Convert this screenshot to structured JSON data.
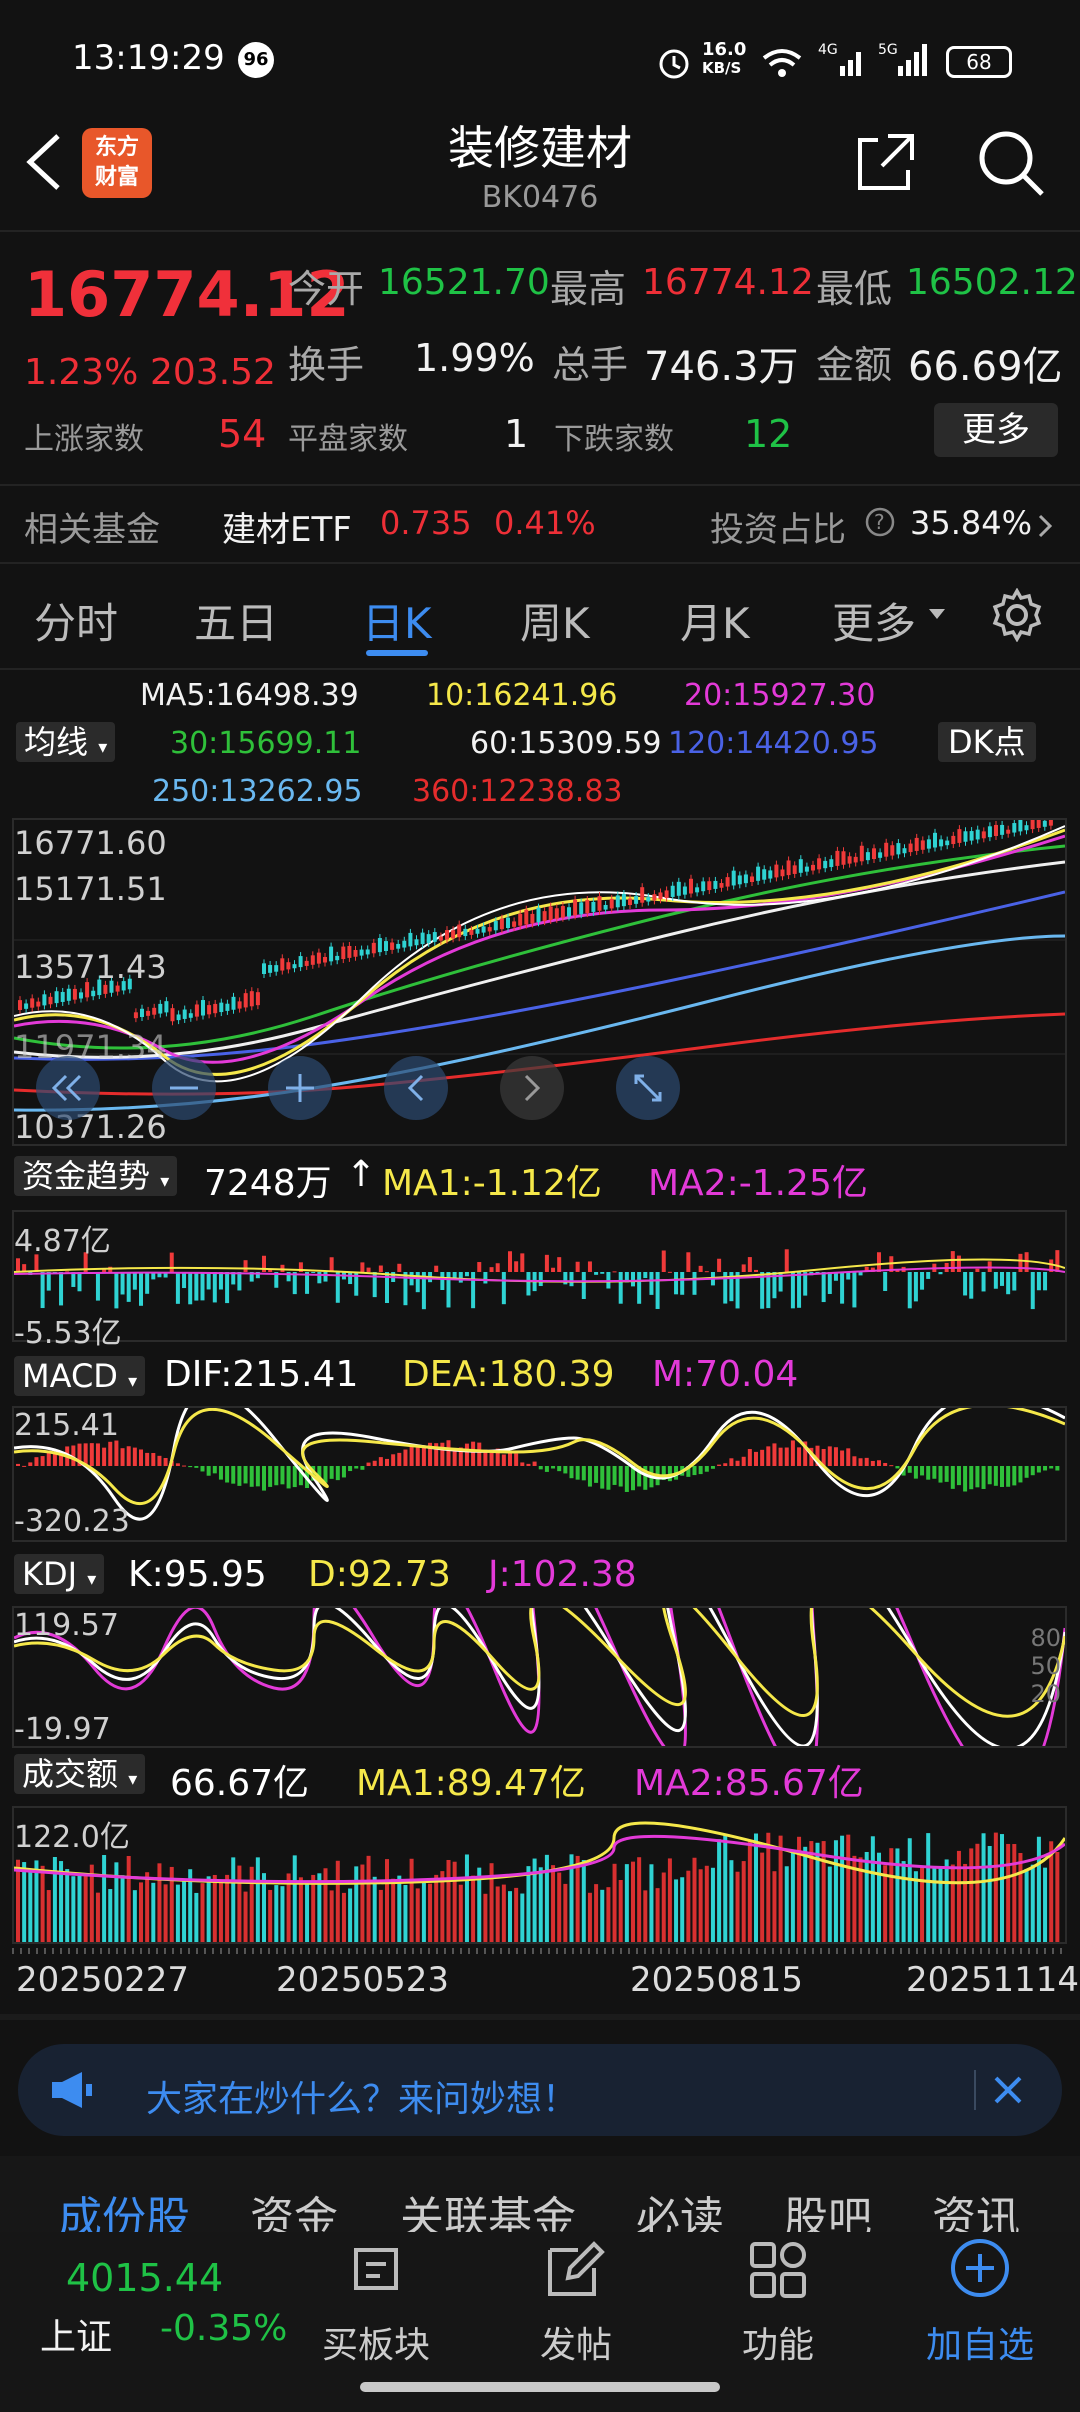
{
  "status": {
    "time": "13:19:29",
    "notif_badge": "96",
    "net_speed": "16.0",
    "net_unit": "KB/S",
    "battery": "68"
  },
  "header": {
    "title": "装修建材",
    "code": "BK0476",
    "logo_line1": "东方",
    "logo_line2": "财富"
  },
  "quote": {
    "price": "16774.12",
    "change_pct": "1.23%",
    "change_abs": "203.52",
    "open_label": "今开",
    "open": "16521.70",
    "high_label": "最高",
    "high": "16774.12",
    "low_label": "最低",
    "low": "16502.12",
    "turnover_label": "换手",
    "turnover": "1.99%",
    "volume_label": "总手",
    "volume": "746.3万",
    "amount_label": "金额",
    "amount": "66.69亿",
    "up_label": "上涨家数",
    "up": "54",
    "flat_label": "平盘家数",
    "flat": "1",
    "down_label": "下跌家数",
    "down": "12",
    "more": "更多"
  },
  "fund": {
    "label": "相关基金",
    "name": "建材ETF",
    "price": "0.735",
    "pct": "0.41%",
    "ratio_label": "投资占比",
    "ratio": "35.84%"
  },
  "tabs": [
    "分时",
    "五日",
    "日K",
    "周K",
    "月K",
    "更多"
  ],
  "ma": {
    "selector": "均线",
    "dk": "DK点",
    "ma5": "MA5:16498.39",
    "ma10": "10:16241.96",
    "ma20": "20:15927.30",
    "ma30": "30:15699.11",
    "ma60": "60:15309.59",
    "ma120": "120:14420.95",
    "ma250": "250:13262.95",
    "ma360": "360:12238.83"
  },
  "kline": {
    "y1": "16771.60",
    "y2": "15171.51",
    "y3": "13571.43",
    "y4": "11971.34",
    "y5": "10371.26"
  },
  "capital": {
    "selector": "资金趋势",
    "value": "7248万",
    "ma1": "MA1:-1.12亿",
    "ma2": "MA2:-1.25亿",
    "top": "4.87亿",
    "bottom": "-5.53亿"
  },
  "macd": {
    "selector": "MACD",
    "dif": "DIF:215.41",
    "dea": "DEA:180.39",
    "m": "M:70.04",
    "top": "215.41",
    "bottom": "-320.23"
  },
  "kdj": {
    "selector": "KDJ",
    "k": "K:95.95",
    "d": "D:92.73",
    "j": "J:102.38",
    "top": "119.57",
    "bottom": "-19.97",
    "l80": "80",
    "l50": "50",
    "l20": "20"
  },
  "vol": {
    "selector": "成交额",
    "value": "66.67亿",
    "ma1": "MA1:89.47亿",
    "ma2": "MA2:85.67亿",
    "top": "122.0亿"
  },
  "dates": [
    "20250227",
    "20250523",
    "20250815",
    "20251114"
  ],
  "banner": "大家在炒什么？来问妙想！",
  "bottom_tabs": [
    "成份股",
    "资金",
    "关联基金",
    "必读",
    "股吧",
    "资讯"
  ],
  "nav": {
    "index_value": "4015.44",
    "index_name": "上证",
    "index_pct": "-0.35%",
    "buy": "买板块",
    "post": "发帖",
    "func": "功能",
    "add": "加自选"
  }
}
